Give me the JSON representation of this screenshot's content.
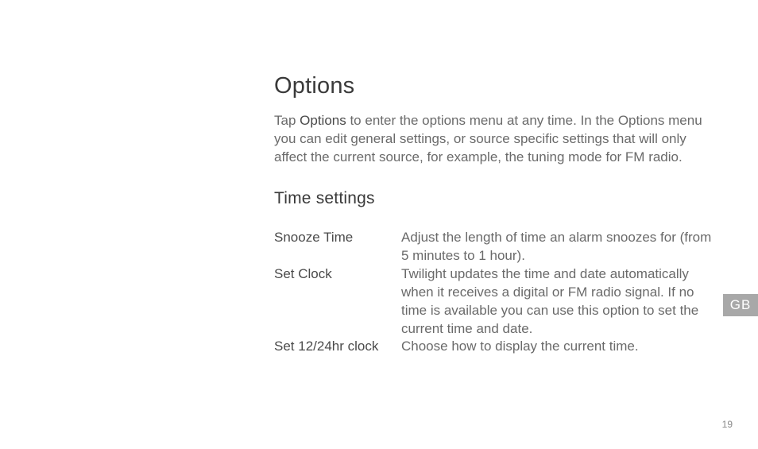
{
  "heading": "Options",
  "intro": {
    "prefix": "Tap ",
    "bold": "Options",
    "rest": " to enter the options menu at any time. In the Options menu you can edit general settings, or source specific settings that will only affect the current source, for example, the tuning mode for FM radio."
  },
  "subheading": "Time settings",
  "settings": [
    {
      "label": "Snooze Time",
      "desc": "Adjust the length of time an alarm snoozes for (from 5 minutes to 1 hour)."
    },
    {
      "label": "Set Clock",
      "desc": "Twilight updates the time and date automatically when it receives a digital or FM radio signal. If no time is available you can use this option to set the current time and date."
    },
    {
      "label": "Set 12/24hr clock",
      "desc": "Choose how to display the current time."
    }
  ],
  "langTab": "GB",
  "pageNumber": "19"
}
